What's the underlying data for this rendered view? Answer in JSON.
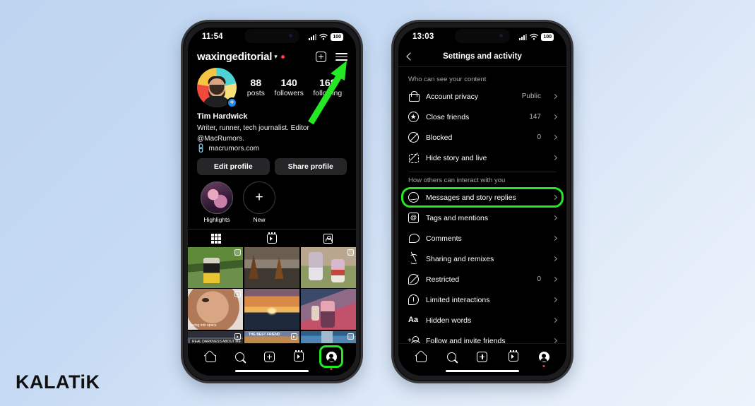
{
  "background": {
    "gradient_from": "#bed4f0",
    "gradient_to": "#edf3fb"
  },
  "brand": {
    "label": "KALATiK"
  },
  "accents": {
    "highlight_green": "#25e825",
    "notification_red": "#ff3b4e",
    "badge_blue": "#1d8cf0"
  },
  "phone_left": {
    "status_bar": {
      "time": "11:54",
      "battery": "100",
      "signal_icon": "cellular-bars-icon",
      "wifi_icon": "wifi-icon"
    },
    "header": {
      "username": "waxingeditorial",
      "chevron": "⌄",
      "new_post_icon": "plus-box-icon",
      "menu_icon": "hamburger-menu-icon"
    },
    "stats": [
      {
        "number": "88",
        "label": "posts"
      },
      {
        "number": "140",
        "label": "followers"
      },
      {
        "number": "168",
        "label": "following"
      }
    ],
    "bio": {
      "name": "Tim Hardwick",
      "description": "Writer, runner, tech journalist. Editor @MacRumors.",
      "link_icon": "link-icon",
      "link": "macrumors.com"
    },
    "actions": [
      {
        "label": "Edit profile"
      },
      {
        "label": "Share profile"
      }
    ],
    "highlights": [
      {
        "label": "Highlights",
        "type": "image"
      },
      {
        "label": "New",
        "type": "add"
      }
    ],
    "tabs": [
      {
        "icon": "grid-icon",
        "name": "tab-grid"
      },
      {
        "icon": "reels-icon",
        "name": "tab-reels"
      },
      {
        "icon": "tagged-icon",
        "name": "tab-tagged"
      }
    ],
    "grid": [
      {
        "alt": "child in costume at outdoor event",
        "badge": "carousel",
        "caption": ""
      },
      {
        "alt": "distillery interior with copper stills",
        "badge": "",
        "caption": ""
      },
      {
        "alt": "two children outdoors in pink",
        "badge": "carousel",
        "caption": ""
      },
      {
        "alt": "baby with sprinkles on face",
        "badge": "reel",
        "caption": "crying into space"
      },
      {
        "alt": "sunset over the sea",
        "badge": "",
        "caption": ""
      },
      {
        "alt": "girl with milkshake in diner",
        "badge": "",
        "caption": ""
      },
      {
        "alt": "night street scene",
        "badge": "reel",
        "caption": "REAL DARKNESS ABOUT ME"
      },
      {
        "alt": "food close up",
        "badge": "reel",
        "caption": "THE BEST FRIEND"
      },
      {
        "alt": "city skyline building",
        "badge": "carousel",
        "caption": ""
      }
    ],
    "bottom_nav": [
      {
        "icon": "home-icon",
        "name": "nav-home",
        "active": false
      },
      {
        "icon": "search-icon",
        "name": "nav-search",
        "active": false
      },
      {
        "icon": "create-icon",
        "name": "nav-create",
        "active": false
      },
      {
        "icon": "reels-icon",
        "name": "nav-reels",
        "active": false
      },
      {
        "icon": "profile-icon",
        "name": "nav-profile",
        "active": true
      }
    ]
  },
  "phone_right": {
    "status_bar": {
      "time": "13:03",
      "battery": "100",
      "signal_icon": "cellular-bars-icon",
      "wifi_icon": "wifi-icon"
    },
    "header": {
      "back_icon": "chevron-left-icon",
      "title": "Settings and activity"
    },
    "sections": [
      {
        "title": "Who can see your content",
        "rows": [
          {
            "icon": "lock-icon",
            "label": "Account privacy",
            "value": "Public",
            "highlighted": false
          },
          {
            "icon": "star-circle-icon",
            "label": "Close friends",
            "value": "147",
            "highlighted": false
          },
          {
            "icon": "block-icon",
            "label": "Blocked",
            "value": "0",
            "highlighted": false
          },
          {
            "icon": "hide-story-icon",
            "label": "Hide story and live",
            "value": "",
            "highlighted": false
          }
        ]
      },
      {
        "title": "How others can interact with you",
        "rows": [
          {
            "icon": "messenger-icon",
            "label": "Messages and story replies",
            "value": "",
            "highlighted": true
          },
          {
            "icon": "at-mention-icon",
            "label": "Tags and mentions",
            "value": "",
            "highlighted": false
          },
          {
            "icon": "comment-icon",
            "label": "Comments",
            "value": "",
            "highlighted": false
          },
          {
            "icon": "share-remix-icon",
            "label": "Sharing and remixes",
            "value": "",
            "highlighted": false
          },
          {
            "icon": "restricted-icon",
            "label": "Restricted",
            "value": "0",
            "highlighted": false
          },
          {
            "icon": "limited-interactions-icon",
            "label": "Limited interactions",
            "value": "",
            "highlighted": false
          },
          {
            "icon": "hidden-words-icon",
            "label": "Hidden words",
            "value": "",
            "highlighted": false
          },
          {
            "icon": "follow-invite-icon",
            "label": "Follow and invite friends",
            "value": "",
            "highlighted": false
          }
        ]
      }
    ],
    "bottom_nav": [
      {
        "icon": "home-icon",
        "name": "nav-home",
        "active": false
      },
      {
        "icon": "search-icon",
        "name": "nav-search",
        "active": false
      },
      {
        "icon": "create-icon",
        "name": "nav-create",
        "active": false
      },
      {
        "icon": "reels-icon",
        "name": "nav-reels",
        "active": false
      },
      {
        "icon": "profile-icon",
        "name": "nav-profile",
        "active": true
      }
    ]
  },
  "annotations": {
    "arrow": {
      "name": "green-arrow-pointing-to-menu",
      "color": "#25e825",
      "points_to": "hamburger-menu-icon"
    },
    "box_messages": {
      "name": "green-highlight-box-messages-row",
      "color": "#25e825"
    },
    "box_profile_tab": {
      "name": "green-highlight-box-profile-nav",
      "color": "#25e825"
    }
  }
}
